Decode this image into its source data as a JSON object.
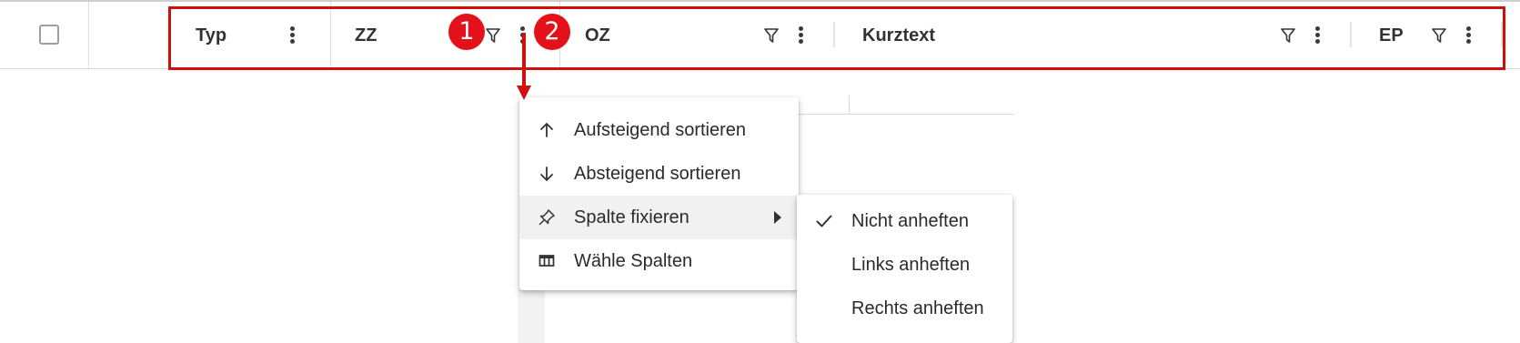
{
  "grid_header": {
    "columns": [
      {
        "label": "Typ"
      },
      {
        "label": "ZZ"
      },
      {
        "label": "OZ"
      },
      {
        "label": "Kurztext"
      },
      {
        "label": "EP"
      }
    ]
  },
  "annotations": {
    "badge_1": "1",
    "badge_2": "2",
    "color": "#d10f0f"
  },
  "column_menu": {
    "items": [
      {
        "label": "Aufsteigend sortieren",
        "icon": "arrow-up-icon"
      },
      {
        "label": "Absteigend sortieren",
        "icon": "arrow-down-icon"
      },
      {
        "label": "Spalte fixieren",
        "icon": "pin-icon",
        "has_submenu": true,
        "active": true
      },
      {
        "label": "Wähle Spalten",
        "icon": "columns-icon"
      }
    ]
  },
  "pin_submenu": {
    "items": [
      {
        "label": "Nicht anheften",
        "checked": true
      },
      {
        "label": "Links anheften",
        "checked": false
      },
      {
        "label": "Rechts anheften",
        "checked": false
      }
    ]
  },
  "icons": {
    "filter": "filter-icon",
    "menu": "kebab-menu-icon",
    "check": "check-icon",
    "submenu": "chevron-right-icon"
  }
}
